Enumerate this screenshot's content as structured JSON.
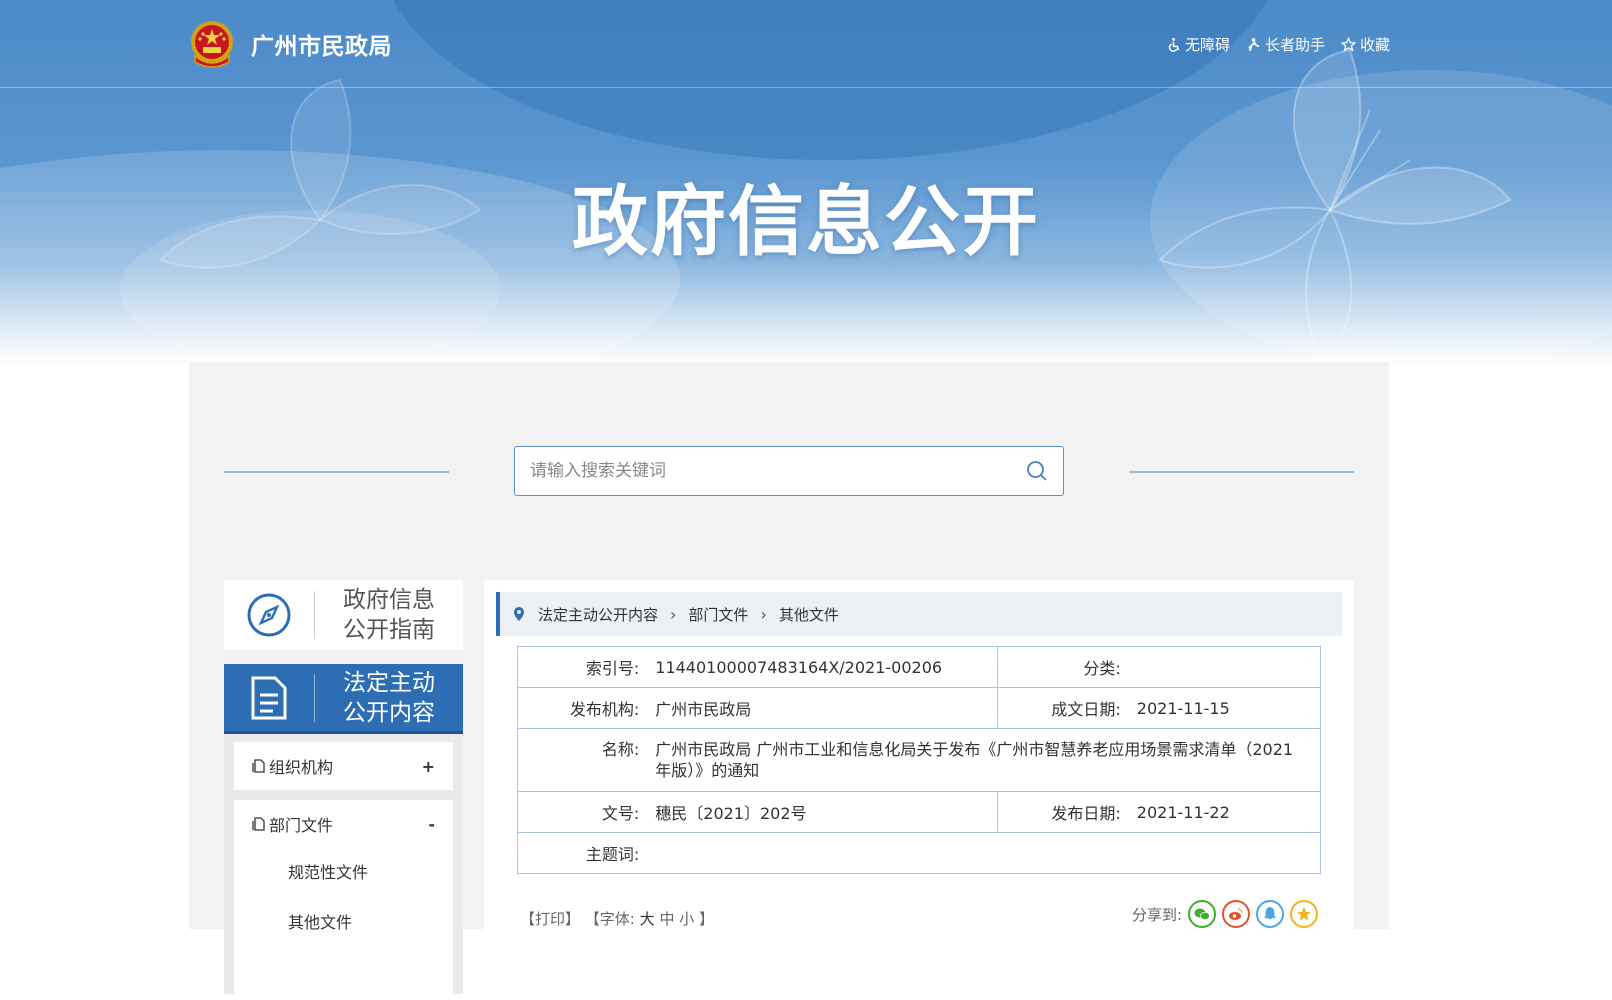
{
  "header": {
    "site_name": "广州市民政局",
    "links": [
      {
        "label": "无障碍",
        "icon": "wheelchair-icon"
      },
      {
        "label": "长者助手",
        "icon": "elder-icon"
      },
      {
        "label": "收藏",
        "icon": "star-outline-icon"
      }
    ],
    "hero_title": "政府信息公开"
  },
  "search": {
    "placeholder": "请输入搜索关键词"
  },
  "sidebar": {
    "guide_line1": "政府信息",
    "guide_line2": "公开指南",
    "active_line1": "法定主动",
    "active_line2": "公开内容",
    "items": [
      {
        "label": "组织机构",
        "sign": "+"
      },
      {
        "label": "部门文件",
        "sign": "-"
      }
    ],
    "sub_items": [
      {
        "label": "规范性文件"
      },
      {
        "label": "其他文件"
      }
    ]
  },
  "breadcrumb": [
    "法定主动公开内容",
    "部门文件",
    "其他文件"
  ],
  "meta": {
    "index_label": "索引号:",
    "index_value": "11440100007483164X/2021-00206",
    "category_label": "分类:",
    "category_value": "",
    "publisher_label": "发布机构:",
    "publisher_value": "广州市民政局",
    "created_label": "成文日期:",
    "created_value": "2021-11-15",
    "name_label": "名称:",
    "name_value": "广州市民政局 广州市工业和信息化局关于发布《广州市智慧养老应用场景需求清单（2021年版）》的通知",
    "docno_label": "文号:",
    "docno_value": "穗民〔2021〕202号",
    "published_label": "发布日期:",
    "published_value": "2021-11-22",
    "keywords_label": "主题词:",
    "keywords_value": ""
  },
  "tools": {
    "print": "【打印】",
    "font_prefix": "【字体:",
    "font_large": "大",
    "font_medium": "中",
    "font_small": "小",
    "font_suffix": "】"
  },
  "share": {
    "label": "分享到:",
    "targets": [
      {
        "name": "wechat-icon",
        "color": "#3fae29"
      },
      {
        "name": "weibo-icon",
        "color": "#e6512d"
      },
      {
        "name": "qq-icon",
        "color": "#4aa6e6"
      },
      {
        "name": "qzone-icon",
        "color": "#f2b31b"
      }
    ]
  },
  "colors": {
    "brand_blue": "#2c6db4",
    "banner_blue": "#4c8ac8",
    "border_blue": "#a9c4e4"
  }
}
